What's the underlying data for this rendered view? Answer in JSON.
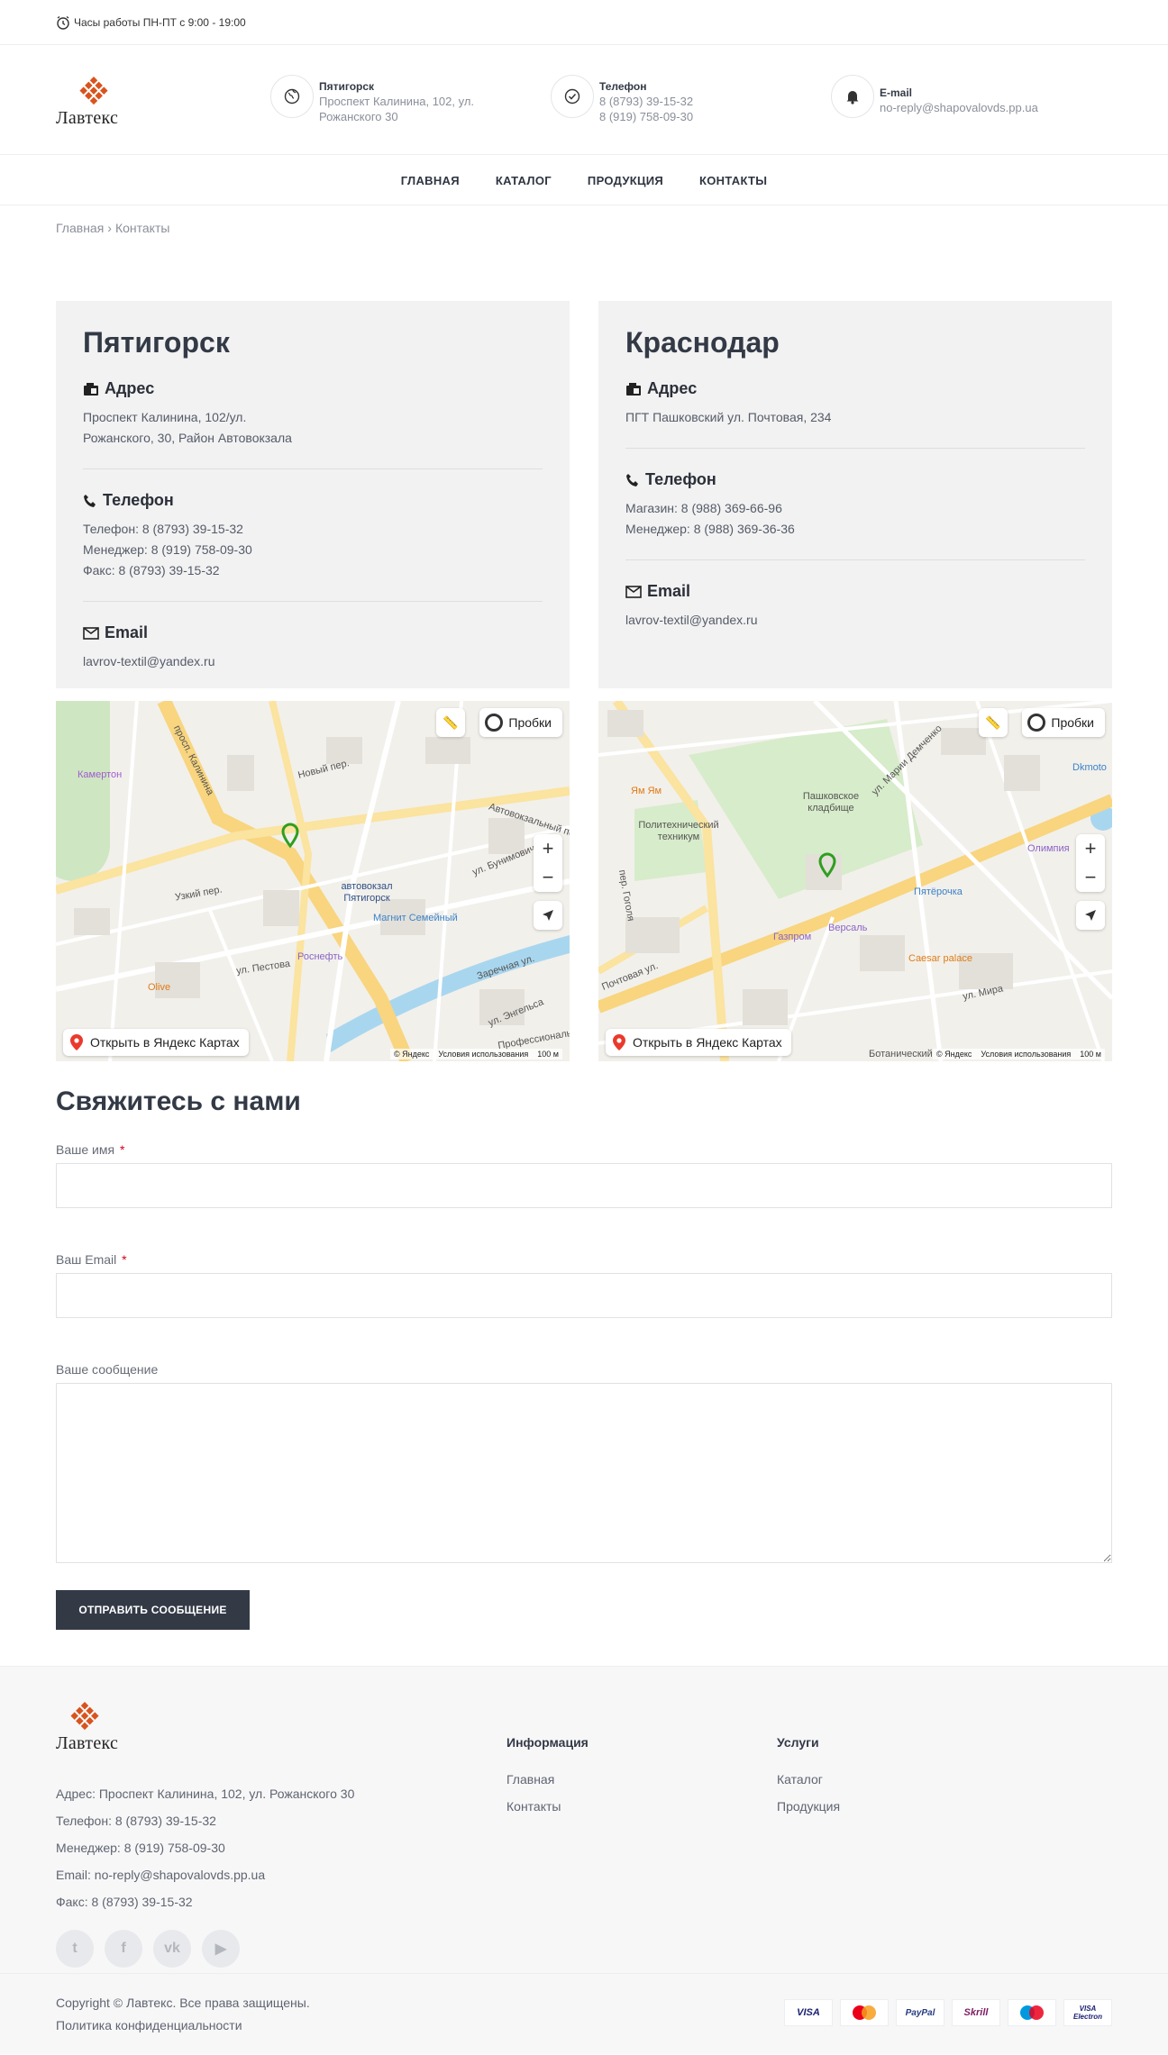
{
  "topbar": {
    "hours": "Часы работы ПН-ПТ с 9:00 - 19:00"
  },
  "header": {
    "logo_text": "Лавтекс",
    "city": {
      "title": "Пятигорск",
      "line1": "Проспект Калинина, 102, ул.",
      "line2": "Рожанского 30"
    },
    "phone": {
      "title": "Телефон",
      "line1": "8 (8793) 39-15-32",
      "line2": "8 (919) 758-09-30"
    },
    "email": {
      "title": "E-mail",
      "line1": "no-reply@shapovalovds.pp.ua"
    }
  },
  "nav": {
    "items": [
      "ГЛАВНАЯ",
      "КАТАЛОГ",
      "ПРОДУКЦИЯ",
      "КОНТАКТЫ"
    ]
  },
  "breadcrumb": {
    "home": "Главная",
    "current": "Контакты"
  },
  "cards": [
    {
      "city": "Пятигорск",
      "address_title": "Адрес",
      "address_lines": [
        "Проспект Калинина, 102/ул.",
        "Рожанского, 30, Район Автовокзала"
      ],
      "phone_title": "Телефон",
      "phone_lines": [
        "Телефон: 8 (8793) 39-15-32",
        "Менеджер: 8 (919) 758-09-30",
        "Факс: 8 (8793) 39-15-32"
      ],
      "email_title": "Email",
      "email": "lavrov-textil@yandex.ru"
    },
    {
      "city": "Краснодар",
      "address_title": "Адрес",
      "address_lines": [
        "ПГТ Пашковский ул. Почтовая, 234"
      ],
      "phone_title": "Телефон",
      "phone_lines": [
        "Магазин: 8 (988) 369-66-96",
        "Менеджер: 8 (988) 369-36-36"
      ],
      "email_title": "Email",
      "email": "lavrov-textil@yandex.ru"
    }
  ],
  "maps": {
    "probki": "Пробки",
    "open_label": "Открыть в Яндекс Картах",
    "copyright": "© Яндекс",
    "terms": "Условия использования",
    "scale": "100 м",
    "map1_labels": [
      "просп. Калинина",
      "Камертон",
      "автовокзал Пятигорск",
      "Магнит Семейный",
      "Роснефть",
      "Olive",
      "ул. Пестова",
      "Заречная ул.",
      "ул. Бунимовича",
      "Узкий пер.",
      "Новый пер.",
      "Автовокзальный пер.",
      "ул. Энгельса",
      "Профессиональ"
    ],
    "map2_labels": [
      "Пашковское кладбище",
      "Политехнический техникум",
      "Ям Ям",
      "Пятёрочка",
      "Версаль",
      "Газпром",
      "Caesar palace",
      "Олимпия",
      "Dkmoto",
      "ул. Мира",
      "пер. Гоголя",
      "Почтовая ул.",
      "ул. Марии Демченко",
      "Ботанический"
    ]
  },
  "form": {
    "title": "Свяжитесь с нами",
    "name_label": "Ваше имя",
    "email_label": "Ваш Email",
    "message_label": "Ваше сообщение",
    "required_mark": "*",
    "submit": "ОТПРАВИТЬ СООБЩЕНИЕ"
  },
  "footer": {
    "logo_text": "Лавтекс",
    "lines": [
      "Адрес: Проспект Калинина, 102, ул. Рожанского 30",
      "Телефон: 8 (8793) 39-15-32",
      "Менеджер: 8 (919) 758-09-30",
      "Email: no-reply@shapovalovds.pp.ua",
      "Факс: 8 (8793) 39-15-32"
    ],
    "socials": [
      "twitter-icon",
      "facebook-icon",
      "vk-icon",
      "youtube-icon"
    ],
    "info_title": "Информация",
    "info_links": [
      "Главная",
      "Контакты"
    ],
    "services_title": "Услуги",
    "services_links": [
      "Каталог",
      "Продукция"
    ],
    "copyright": "Copyright © Лавтекс. Все права защищены.",
    "privacy": "Политика конфиденциальности",
    "payments": [
      "VISA",
      "MasterCard",
      "PayPal",
      "Skrill",
      "Maestro",
      "VISA Electron"
    ]
  },
  "colors": {
    "dark": "#333a46",
    "card_bg": "#f2f2f3",
    "logo": "#d9531e",
    "pin": "#2f9e1f"
  }
}
